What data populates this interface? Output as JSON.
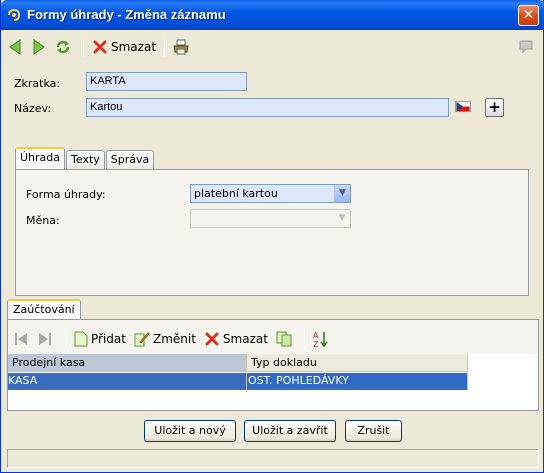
{
  "window": {
    "title": "Formy úhrady - Změna záznamu",
    "close_symbol": "✕"
  },
  "toolbar": {
    "delete_label": "Smazat",
    "icons": [
      "back-arrow-icon",
      "forward-arrow-icon",
      "refresh-icon",
      "delete-x-icon",
      "print-icon",
      "help-balloon-icon"
    ]
  },
  "form": {
    "code_label": "Zkratka:",
    "code_value": "KARTA",
    "name_label": "Název:",
    "name_value": "Kartou",
    "plus_symbol": "+"
  },
  "tabs": [
    {
      "label": "Úhrada",
      "active": true
    },
    {
      "label": "Texty",
      "active": false
    },
    {
      "label": "Správa",
      "active": false
    }
  ],
  "payment": {
    "form_label": "Forma úhrady:",
    "form_value": "platební kartou",
    "currency_label": "Měna:",
    "currency_value": ""
  },
  "accounting": {
    "tab_label": "Zaúčtování",
    "add_label": "Přidat",
    "edit_label": "Změnit",
    "delete_label": "Smazat",
    "columns": [
      "Prodejní kasa",
      "Typ dokladu"
    ],
    "rows": [
      [
        "KASA",
        "OST. POHLEDÁVKY"
      ]
    ]
  },
  "buttons": {
    "save_new": "Uložit a nový",
    "save_close": "Uložit a zavřít",
    "cancel": "Zrušit"
  },
  "colors": {
    "title_bar": "#0058e6",
    "selection": "#316ac5",
    "field_bg": "#dce7fb",
    "tab_highlight": "#ffc83c"
  }
}
